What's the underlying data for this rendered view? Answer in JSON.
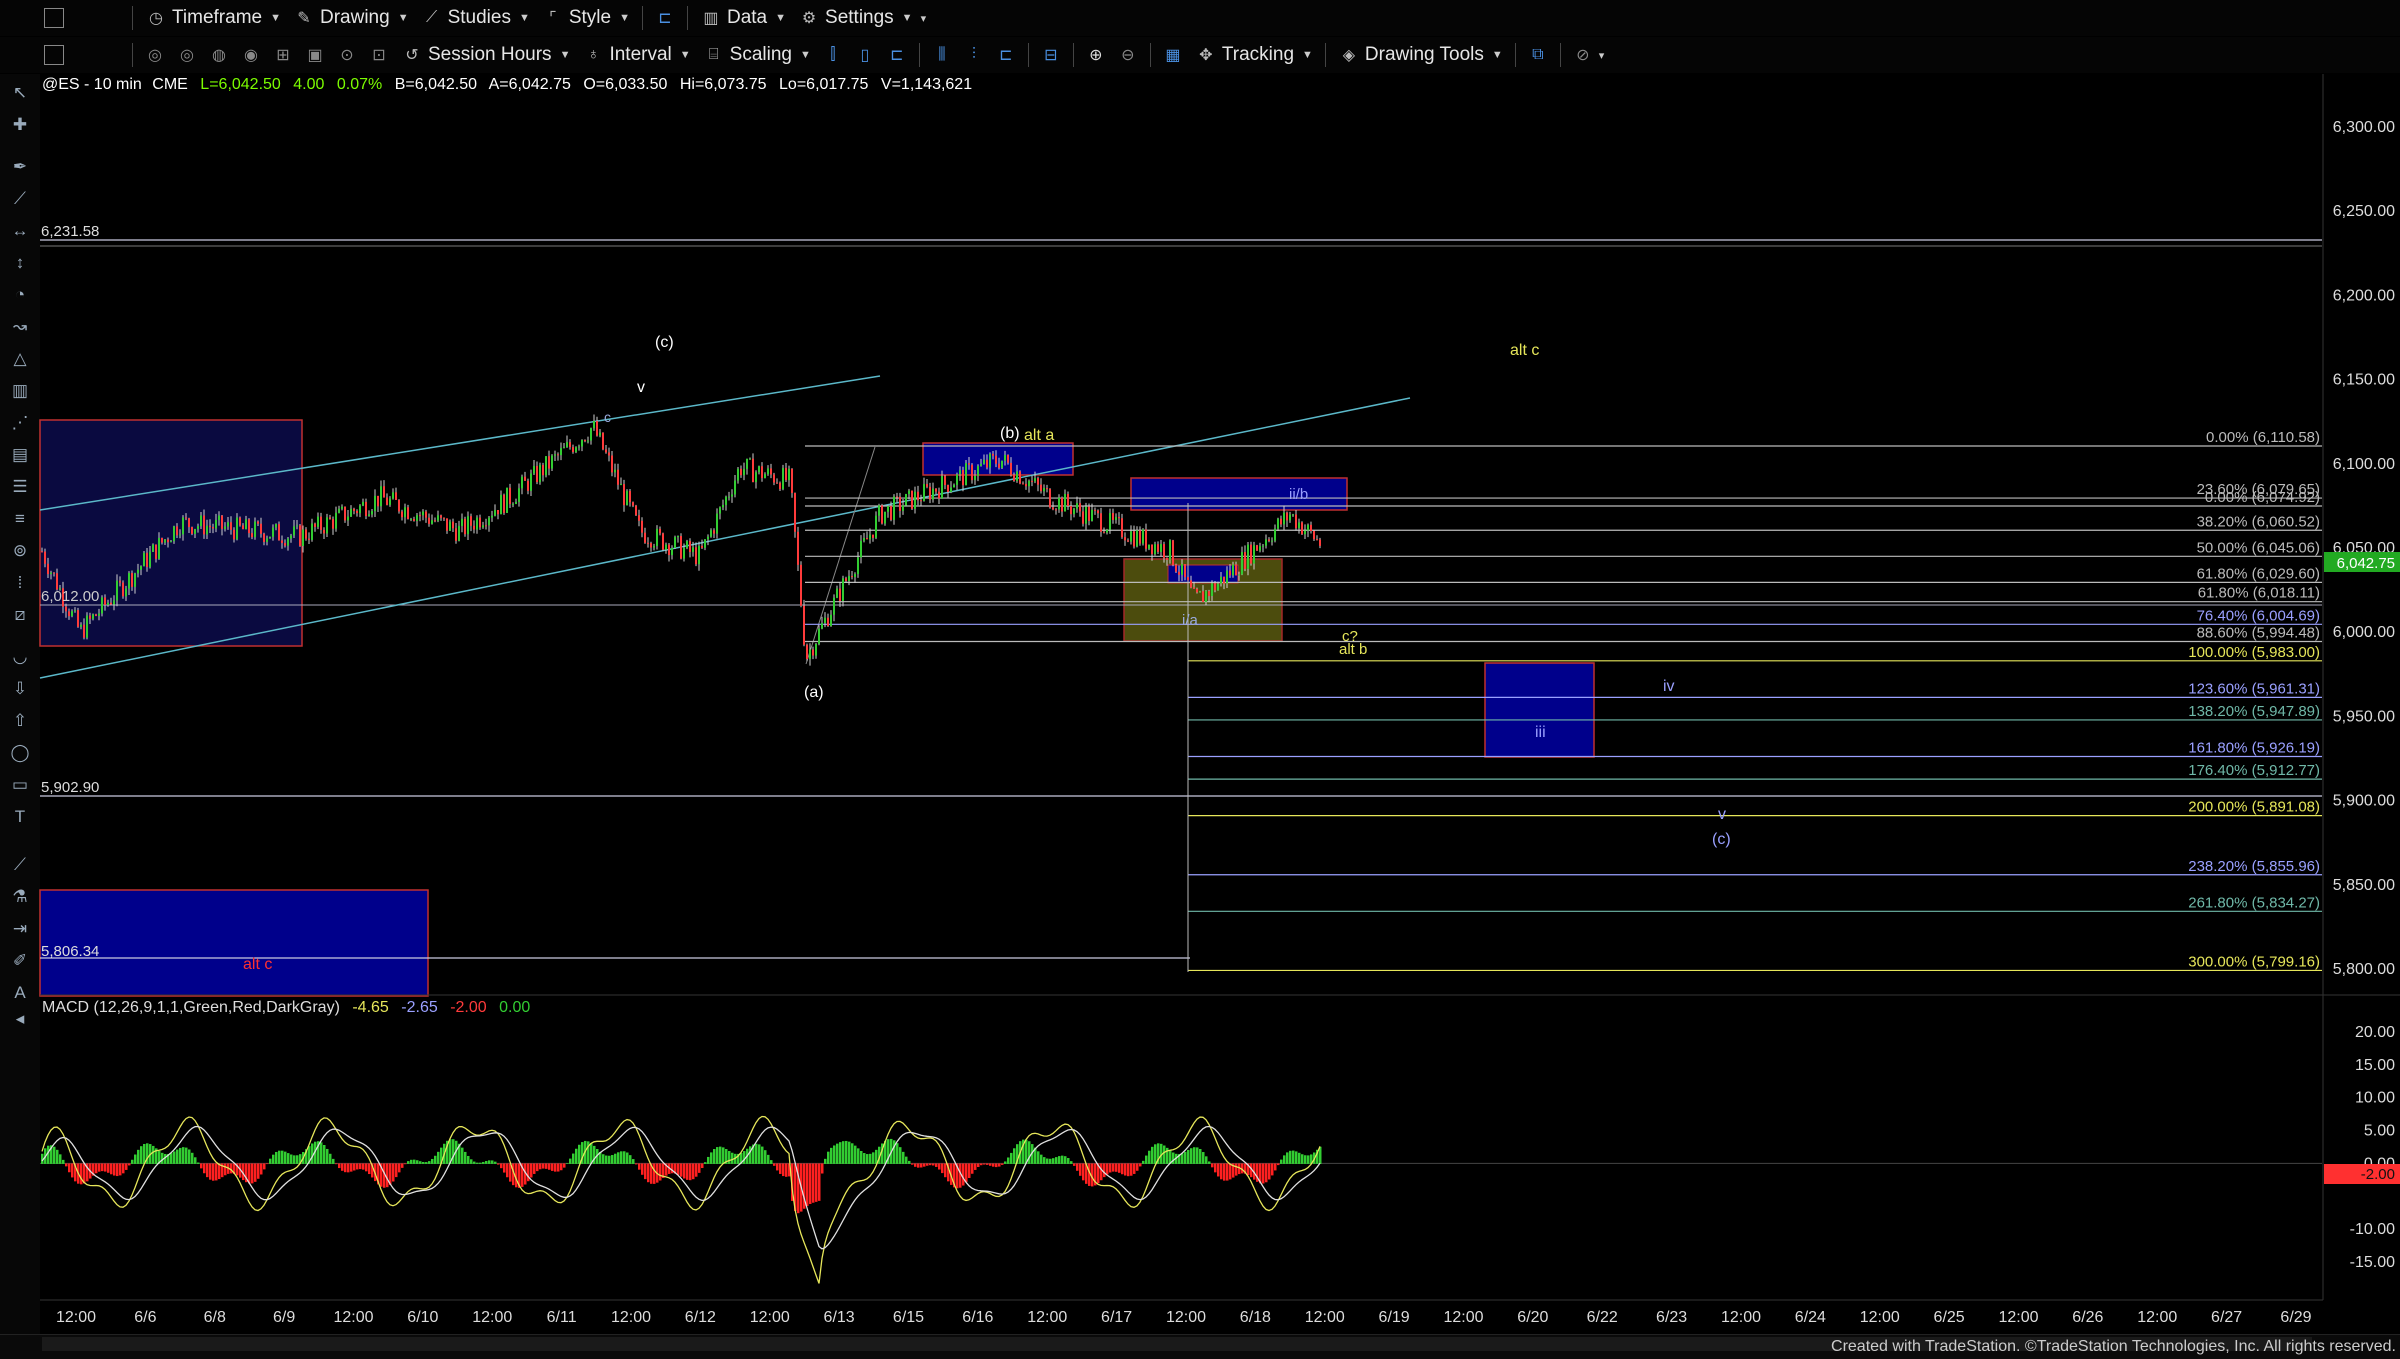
{
  "toolbar1": {
    "items": [
      {
        "label": "Timeframe",
        "icon": "clock-icon"
      },
      {
        "label": "Drawing",
        "icon": "pencil-icon"
      },
      {
        "label": "Studies",
        "icon": "chart-line-icon"
      },
      {
        "label": "Style",
        "icon": "bracket-icon"
      }
    ],
    "items2": [
      {
        "label": "Data",
        "icon": "bar-chart-icon"
      },
      {
        "label": "Settings",
        "icon": "gear-icon"
      }
    ]
  },
  "toolbar2": {
    "session_hours": "Session Hours",
    "interval": "Interval",
    "scaling": "Scaling",
    "tracking": "Tracking",
    "drawing_tools": "Drawing Tools"
  },
  "header": {
    "symbol": "@ES - 10 min",
    "exchange": "CME",
    "last": "L=6,042.50",
    "change": "4.00",
    "pct": "0.07%",
    "bid": "B=6,042.50",
    "ask": "A=6,042.75",
    "open": "O=6,033.50",
    "high": "Hi=6,073.75",
    "low": "Lo=6,017.75",
    "volume": "V=1,143,621"
  },
  "price_axis": {
    "labels": [
      "6,300.00",
      "6,250.00",
      "6,200.00",
      "6,150.00",
      "6,100.00",
      "6,050.00",
      "6,000.00",
      "5,950.00",
      "5,900.00",
      "5,850.00",
      "5,800.00"
    ],
    "current": "6,042.75"
  },
  "macd": {
    "title": "MACD (12,26,9,1,1,Green,Red,DarkGray)",
    "v1": "-4.65",
    "v2": "-2.65",
    "v3": "-2.00",
    "v4": "0.00",
    "axis_labels": [
      "20.00",
      "15.00",
      "10.00",
      "5.00",
      "0.00",
      "-10.00",
      "-15.00"
    ],
    "current": "-2.00"
  },
  "time_axis": [
    "12:00",
    "6/6",
    "6/8",
    "6/9",
    "12:00",
    "6/10",
    "12:00",
    "6/11",
    "12:00",
    "6/12",
    "12:00",
    "6/13",
    "6/15",
    "6/16",
    "12:00",
    "6/17",
    "12:00",
    "6/18",
    "12:00",
    "6/19",
    "12:00",
    "6/20",
    "6/22",
    "6/23",
    "12:00",
    "6/24",
    "12:00",
    "6/25",
    "12:00",
    "6/26",
    "12:00",
    "6/27",
    "6/29"
  ],
  "level_labels": {
    "l6231": "6,231.58",
    "l5902": "5,902.90",
    "l5806": "5,806.34",
    "l6012": "6,012.00"
  },
  "fib_labels": [
    "0.00% (6,110.58)",
    "23.60% (6,079.65)",
    "0.00% (6,074.92)",
    "38.20% (6,060.52)",
    "50.00% (6,045.06)",
    "61.80% (6,029.60)",
    "61.80% (6,018.11)",
    "76.40% (6,004.69)",
    "88.60% (5,994.48)",
    "100.00% (5,983.00)",
    "123.60% (5,961.31)",
    "138.20% (5,947.89)",
    "161.80% (5,926.19)",
    "176.40% (5,912.77)",
    "200.00% (5,891.08)",
    "238.20% (5,855.96)",
    "261.80% (5,834.27)",
    "300.00% (5,799.16)"
  ],
  "wave_labels": {
    "c_paren": "(c)",
    "v_top": "v",
    "c_small": "c",
    "b_paren": "(b)",
    "alt_a": "alt a",
    "a_paren": "(a)",
    "iib": "ii/b",
    "ia": "i/a",
    "alt_c_yellow": "alt c",
    "c_q": "c?",
    "alt_b": "alt b",
    "iii": "iii",
    "iv": "iv",
    "v_low": "v",
    "c_low": "(c)",
    "alt_c_red": "alt c"
  },
  "footer": {
    "credit": "Created with TradeStation. ©TradeStation Technologies, Inc. All rights reserved."
  },
  "colors": {
    "up": "#32cd32",
    "down": "#ff3b3b",
    "fib_yellow": "#e6e65a",
    "fib_purple": "#9aa0ff",
    "fib_teal": "#6fb8a8",
    "box_blue": "#00008b",
    "trend_cyan": "#5bb8c9"
  }
}
